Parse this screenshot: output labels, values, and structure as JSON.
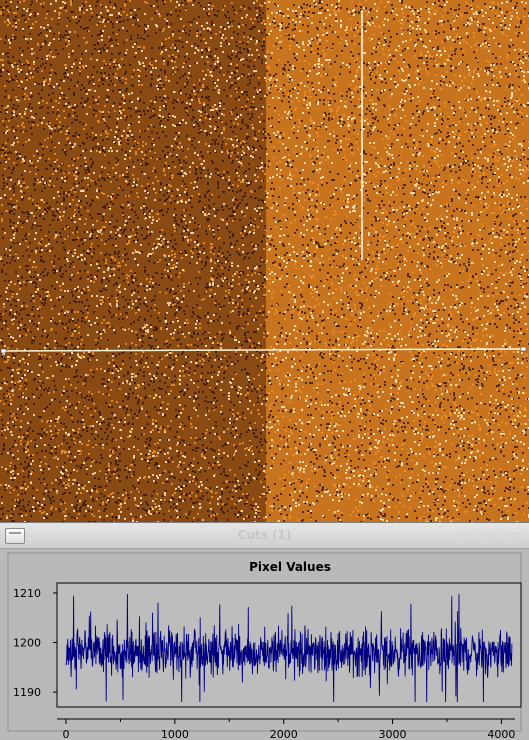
{
  "image_view": {
    "colors": {
      "left_region": "#8a4a14",
      "right_region": "#c8741e",
      "speckle_bright": "#fff2c8",
      "speckle_dark": "#2a1404",
      "cut_line": "#fff7dc"
    }
  },
  "cuts_window": {
    "title": "Cuts (1)",
    "menu_icon": "window-menu-icon",
    "buttons": {
      "shade": "^",
      "maximize": "+",
      "close": "✕"
    }
  },
  "chart_data": {
    "type": "line",
    "title": "Pixel Values",
    "xlabel": "",
    "ylabel": "",
    "xlim": [
      0,
      4180
    ],
    "ylim": [
      1187,
      1212
    ],
    "xticks": [
      0,
      1000,
      2000,
      3000,
      4000
    ],
    "yticks": [
      1190,
      1200,
      1210
    ],
    "grid": false,
    "series": [
      {
        "color": "#000080",
        "x": [
          0,
          4096
        ],
        "baseline": 1198,
        "typical_low": 1193,
        "typical_high": 1203,
        "max": 1210,
        "min": 1188
      }
    ]
  }
}
